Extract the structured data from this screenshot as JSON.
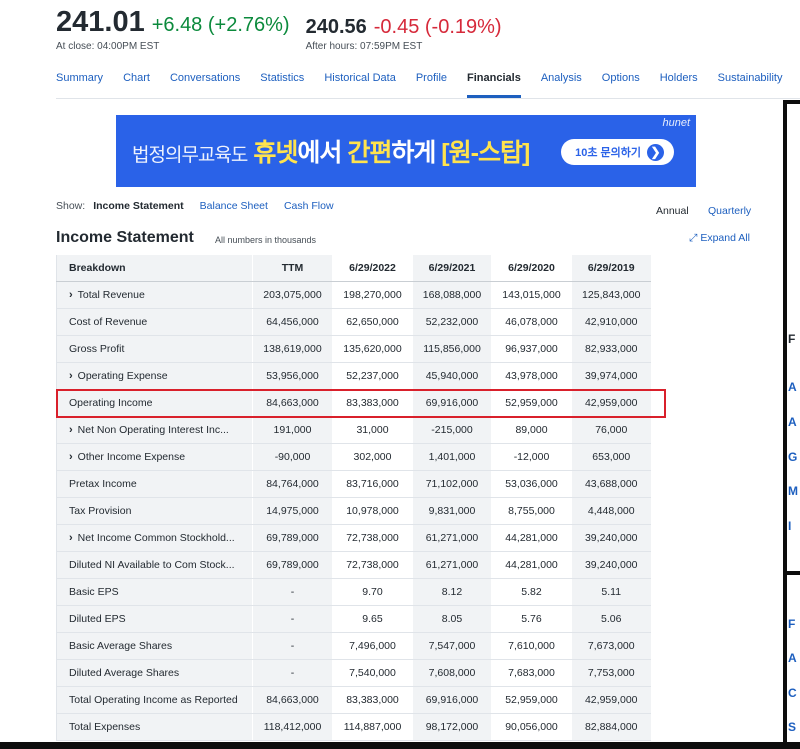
{
  "quote": {
    "price": "241.01",
    "change": "+6.48 (+2.76%)",
    "close_label": "At close: 04:00PM EST",
    "ah_price": "240.56",
    "ah_change": "-0.45 (-0.19%)",
    "ah_label": "After hours: 07:59PM EST"
  },
  "tabs": [
    "Summary",
    "Chart",
    "Conversations",
    "Statistics",
    "Historical Data",
    "Profile",
    "Financials",
    "Analysis",
    "Options",
    "Holders",
    "Sustainability"
  ],
  "active_tab": "Financials",
  "ad": {
    "prefix": "법정의무교육도",
    "highlight1": "휴넷",
    "middle": "에서",
    "highlight2": "간편",
    "suffix": "하게",
    "bracket": "[원-스탑]",
    "cta": "10초 문의하기",
    "brand": "hunet"
  },
  "show": {
    "label": "Show:",
    "options": [
      "Income Statement",
      "Balance Sheet",
      "Cash Flow"
    ],
    "active": "Income Statement"
  },
  "period": {
    "annual": "Annual",
    "quarterly": "Quarterly"
  },
  "statement": {
    "title": "Income Statement",
    "note": "All numbers in thousands",
    "expand": "Expand All"
  },
  "table": {
    "headers": [
      "Breakdown",
      "TTM",
      "6/29/2022",
      "6/29/2021",
      "6/29/2020",
      "6/29/2019"
    ],
    "rows": [
      {
        "label": "Total Revenue",
        "expandable": true,
        "values": [
          "203,075,000",
          "198,270,000",
          "168,088,000",
          "143,015,000",
          "125,843,000"
        ]
      },
      {
        "label": "Cost of Revenue",
        "expandable": false,
        "values": [
          "64,456,000",
          "62,650,000",
          "52,232,000",
          "46,078,000",
          "42,910,000"
        ]
      },
      {
        "label": "Gross Profit",
        "expandable": false,
        "values": [
          "138,619,000",
          "135,620,000",
          "115,856,000",
          "96,937,000",
          "82,933,000"
        ]
      },
      {
        "label": "Operating Expense",
        "expandable": true,
        "values": [
          "53,956,000",
          "52,237,000",
          "45,940,000",
          "43,978,000",
          "39,974,000"
        ]
      },
      {
        "label": "Operating Income",
        "expandable": false,
        "values": [
          "84,663,000",
          "83,383,000",
          "69,916,000",
          "52,959,000",
          "42,959,000"
        ]
      },
      {
        "label": "Net Non Operating Interest Inc...",
        "expandable": true,
        "values": [
          "191,000",
          "31,000",
          "-215,000",
          "89,000",
          "76,000"
        ]
      },
      {
        "label": "Other Income Expense",
        "expandable": true,
        "values": [
          "-90,000",
          "302,000",
          "1,401,000",
          "-12,000",
          "653,000"
        ]
      },
      {
        "label": "Pretax Income",
        "expandable": false,
        "values": [
          "84,764,000",
          "83,716,000",
          "71,102,000",
          "53,036,000",
          "43,688,000"
        ]
      },
      {
        "label": "Tax Provision",
        "expandable": false,
        "values": [
          "14,975,000",
          "10,978,000",
          "9,831,000",
          "8,755,000",
          "4,448,000"
        ]
      },
      {
        "label": "Net Income Common Stockhold...",
        "expandable": true,
        "values": [
          "69,789,000",
          "72,738,000",
          "61,271,000",
          "44,281,000",
          "39,240,000"
        ]
      },
      {
        "label": "Diluted NI Available to Com Stock...",
        "expandable": false,
        "values": [
          "69,789,000",
          "72,738,000",
          "61,271,000",
          "44,281,000",
          "39,240,000"
        ]
      },
      {
        "label": "Basic EPS",
        "expandable": false,
        "values": [
          "-",
          "9.70",
          "8.12",
          "5.82",
          "5.11"
        ]
      },
      {
        "label": "Diluted EPS",
        "expandable": false,
        "values": [
          "-",
          "9.65",
          "8.05",
          "5.76",
          "5.06"
        ]
      },
      {
        "label": "Basic Average Shares",
        "expandable": false,
        "values": [
          "-",
          "7,496,000",
          "7,547,000",
          "7,610,000",
          "7,673,000"
        ]
      },
      {
        "label": "Diluted Average Shares",
        "expandable": false,
        "values": [
          "-",
          "7,540,000",
          "7,608,000",
          "7,683,000",
          "7,753,000"
        ]
      },
      {
        "label": "Total Operating Income as Reported",
        "expandable": false,
        "values": [
          "84,663,000",
          "83,383,000",
          "69,916,000",
          "52,959,000",
          "42,959,000"
        ]
      },
      {
        "label": "Total Expenses",
        "expandable": false,
        "values": [
          "118,412,000",
          "114,887,000",
          "98,172,000",
          "90,056,000",
          "82,884,000"
        ]
      }
    ]
  },
  "highlighted_row": "Operating Income",
  "sidebar_letters": [
    {
      "text": "F",
      "color": "dark"
    },
    {
      "text": "A",
      "color": "link"
    },
    {
      "text": "A",
      "color": "link"
    },
    {
      "text": "G",
      "color": "link"
    },
    {
      "text": "M",
      "color": "link"
    },
    {
      "text": "I",
      "color": "link"
    },
    {
      "text": "F",
      "color": "link"
    },
    {
      "text": "A",
      "color": "link"
    },
    {
      "text": "C",
      "color": "link"
    },
    {
      "text": "S",
      "color": "link"
    }
  ],
  "colors": {
    "positive": "#0b8a3c",
    "negative": "#d6293a",
    "link": "#1d5fbf",
    "highlight_box": "#d9202b",
    "ad_background": "#2a62e8"
  },
  "icons": {
    "expand_chevron": "chevron-right-icon",
    "expand_all": "expand-arrows-icon",
    "ad_arrow": "arrow-circle-right-icon"
  }
}
